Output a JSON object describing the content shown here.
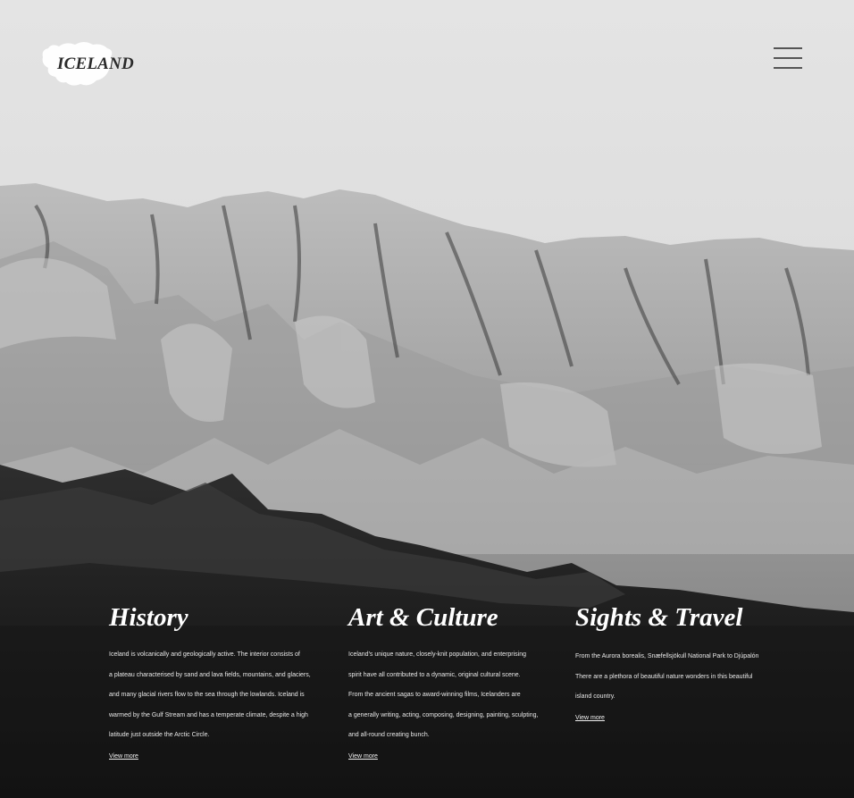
{
  "brand": {
    "name": "ICELAND"
  },
  "menu": {
    "icon": "hamburger-icon"
  },
  "sections": [
    {
      "title": "History",
      "lines": [
        "Iceland is volcanically and geologically active. The interior consists of",
        "a plateau characterised by sand and lava fields, mountains, and glaciers,",
        "and many glacial rivers flow to the sea through the lowlands. Iceland is",
        "warmed by the Gulf Stream and has a temperate climate, despite a high",
        "latitude just outside the Arctic Circle."
      ],
      "link": "View more"
    },
    {
      "title": "Art & Culture",
      "lines": [
        "Iceland's unique nature, closely-knit population, and enterprising",
        " spirit have all contributed to a dynamic, original cultural scene.",
        " From the ancient sagas to  award-winning films, Icelanders are",
        "a generally writing, acting, composing, designing, painting, sculpting,",
        " and all-round creating bunch."
      ],
      "link": "View more"
    },
    {
      "title": "Sights & Travel",
      "lines": [
        "From the Aurora borealis, Snæfellsjökull National Park to Djúpalón",
        "There are a plethora of beautiful nature wonders in this beautiful",
        "island country."
      ],
      "link": "View more"
    }
  ]
}
